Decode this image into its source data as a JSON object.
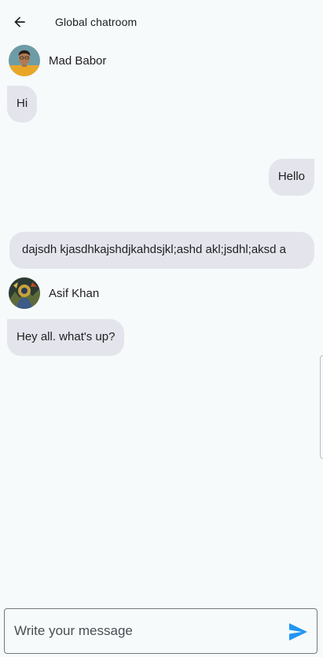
{
  "header": {
    "title": "Global chatroom",
    "back_icon": "arrow-back-icon"
  },
  "messages": [
    {
      "sender": "Mad Babor",
      "text": "Hi",
      "side": "left",
      "show_sender": true
    },
    {
      "text": "Hello",
      "side": "right"
    },
    {
      "text": "dajsdh kjasdhkajshdjkahdsjkl;ashd akl;jsdhl;aksd a",
      "side": "wide"
    },
    {
      "sender": "Asif Khan",
      "text": "Hey all. what's up?",
      "side": "left",
      "show_sender": true
    }
  ],
  "composer": {
    "placeholder": "Write your message",
    "send_icon": "send-icon"
  },
  "colors": {
    "background": "#f6fafb",
    "bubble": "#e4e5ec",
    "send_accent": "#2196f3"
  }
}
